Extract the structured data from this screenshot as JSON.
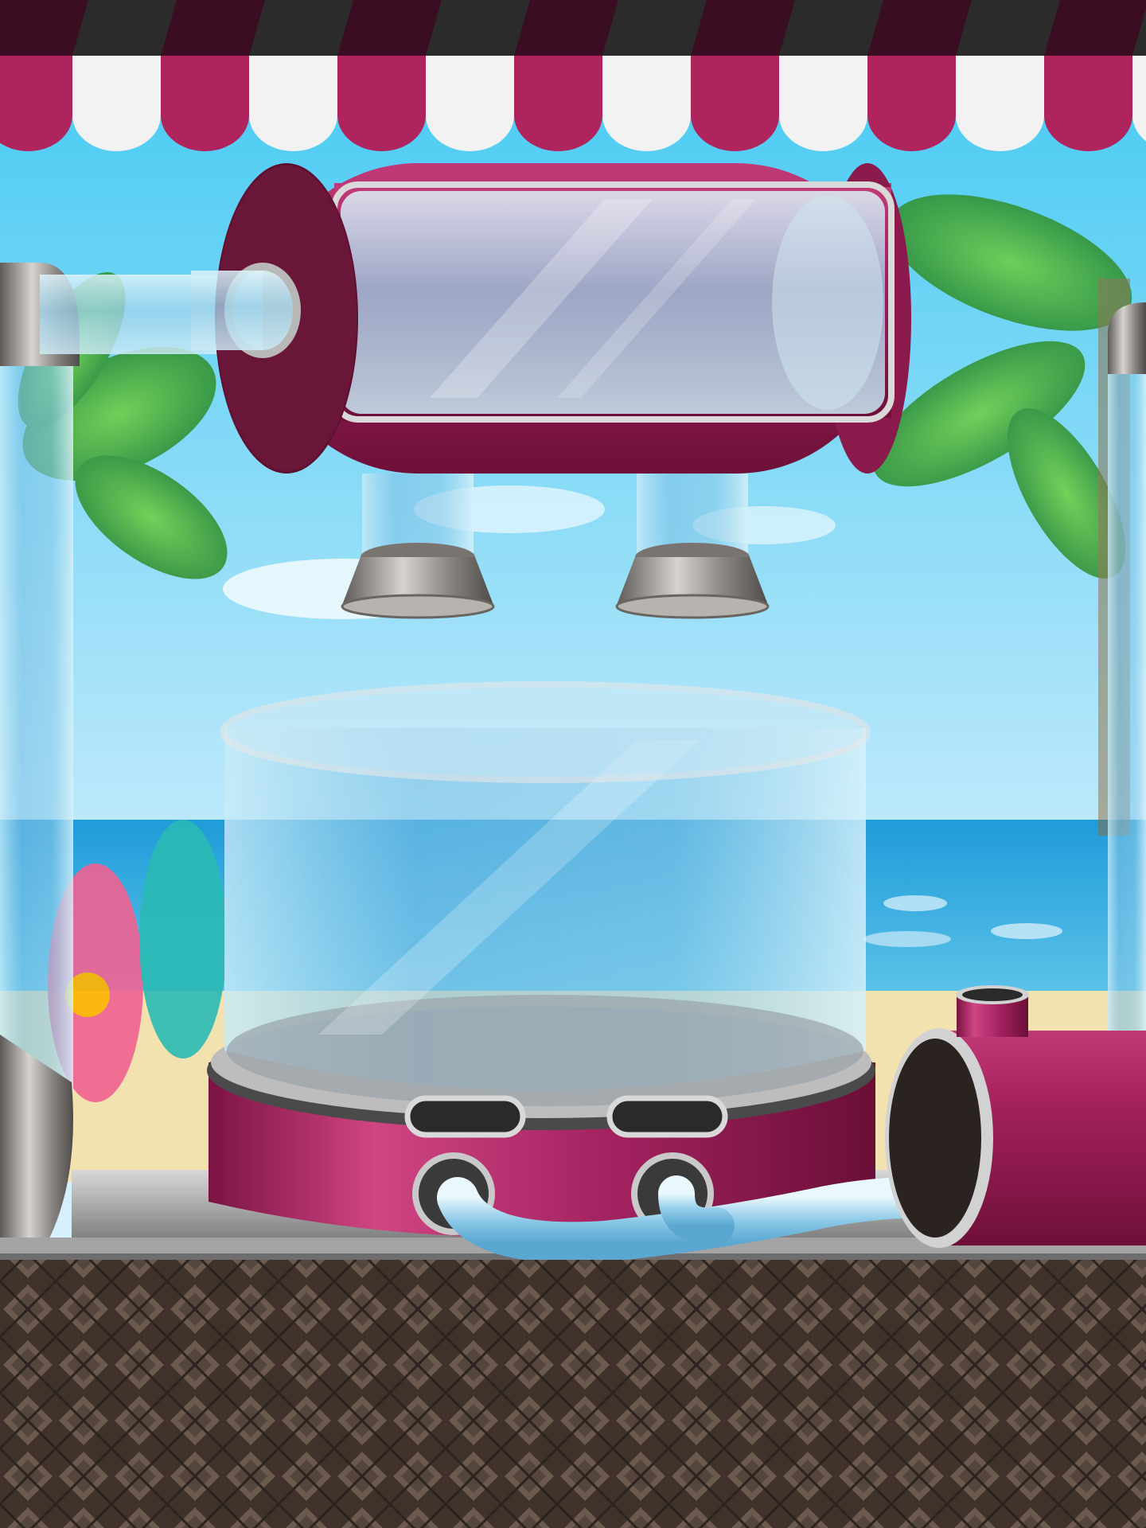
{
  "scene": {
    "type": "juice-maker-machine",
    "setting": "beach-stand",
    "colors": {
      "sky_top": "#3fc8f2",
      "sky_bottom": "#cfeefc",
      "sea": "#2fa7e0",
      "sand": "#f2e2b0",
      "awning_pink": "#b0245e",
      "awning_white": "#f2f2f2",
      "awning_dark": "#2b2b2b",
      "machine_magenta": "#9c1e55",
      "glass": "#bfe6f7",
      "metal": "#a9a9a9",
      "floor_wicker": "#4a3b32"
    },
    "icons": [
      "striped-awning",
      "palm-tree-left",
      "palm-tree-right",
      "surfboard-pink",
      "surfboard-teal",
      "glass-drum",
      "glass-bowl",
      "funnel-nozzle",
      "delivery-tube",
      "wicker-floor"
    ]
  }
}
